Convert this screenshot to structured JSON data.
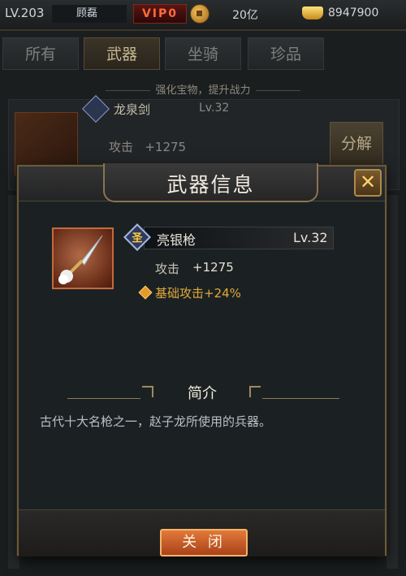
{
  "topbar": {
    "level": "LV.203",
    "player_name": "顾磊",
    "vip": "VIP0",
    "coin_value": "20亿",
    "ingot_value": "8947900"
  },
  "tabs": [
    {
      "label": "所有",
      "active": false
    },
    {
      "label": "武器",
      "active": true
    },
    {
      "label": "坐骑",
      "active": false
    },
    {
      "label": "珍品",
      "active": false
    }
  ],
  "subtitle": "强化宝物，提升战力",
  "background_item": {
    "name": "龙泉剑",
    "level": "Lv.32",
    "attack_label": "攻击",
    "attack_value": "+1275",
    "split_label": "分解"
  },
  "modal": {
    "title": "武器信息",
    "close_icon": "crossed-swords-close-icon",
    "item": {
      "tier": "圣",
      "name": "亮银枪",
      "level": "Lv.32",
      "attack_label": "攻击",
      "attack_value": "+1275",
      "bonus": "基础攻击+24%"
    },
    "intro_title": "简介",
    "description": "古代十大名枪之一，赵子龙所使用的兵器。",
    "close_button": "关 闭"
  },
  "colors": {
    "accent_gold": "#e0a93a",
    "button_orange": "#e27a3a",
    "vip_red": "#ff6a3a"
  }
}
